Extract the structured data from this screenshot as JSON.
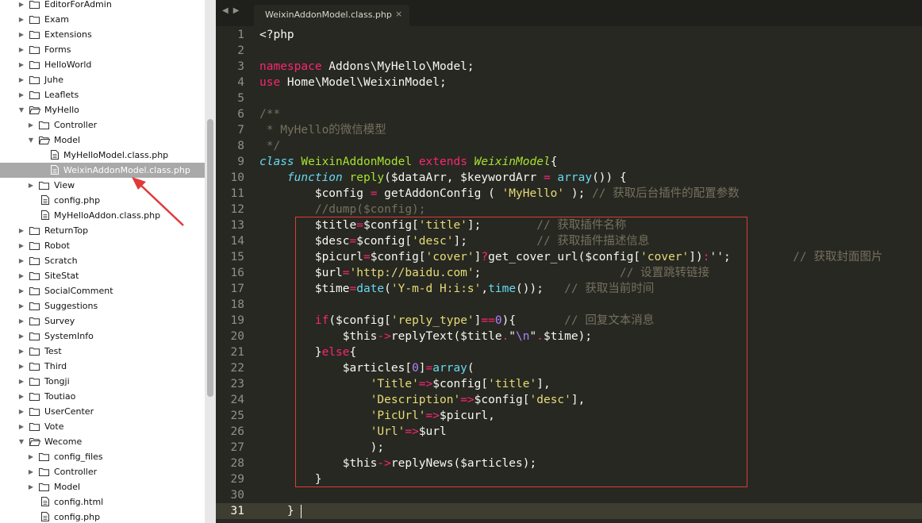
{
  "colors": {
    "editor_bg": "#272822",
    "sidebar_bg": "#ffffff",
    "selected_row_bg": "#a9a9a9",
    "annotation": "#e03a3a",
    "keyword": "#f92672",
    "string": "#e6db74",
    "comment": "#75715e",
    "function": "#66d9ef",
    "class_name": "#a6e22e",
    "number": "#ae81ff"
  },
  "sidebar": {
    "items": [
      {
        "label": "EditorForAdmin",
        "depth": 0,
        "type": "folder",
        "expanded": false
      },
      {
        "label": "Exam",
        "depth": 0,
        "type": "folder",
        "expanded": false
      },
      {
        "label": "Extensions",
        "depth": 0,
        "type": "folder",
        "expanded": false
      },
      {
        "label": "Forms",
        "depth": 0,
        "type": "folder",
        "expanded": false
      },
      {
        "label": "HelloWorld",
        "depth": 0,
        "type": "folder",
        "expanded": false
      },
      {
        "label": "Juhe",
        "depth": 0,
        "type": "folder",
        "expanded": false
      },
      {
        "label": "Leaflets",
        "depth": 0,
        "type": "folder",
        "expanded": false
      },
      {
        "label": "MyHello",
        "depth": 0,
        "type": "folder",
        "expanded": true
      },
      {
        "label": "Controller",
        "depth": 1,
        "type": "folder",
        "expanded": false
      },
      {
        "label": "Model",
        "depth": 1,
        "type": "folder",
        "expanded": true
      },
      {
        "label": "MyHelloModel.class.php",
        "depth": 2,
        "type": "file"
      },
      {
        "label": "WeixinAddonModel.class.php",
        "depth": 2,
        "type": "file",
        "selected": true
      },
      {
        "label": "View",
        "depth": 1,
        "type": "folder",
        "expanded": false
      },
      {
        "label": "config.php",
        "depth": 1,
        "type": "file"
      },
      {
        "label": "MyHelloAddon.class.php",
        "depth": 1,
        "type": "file"
      },
      {
        "label": "ReturnTop",
        "depth": 0,
        "type": "folder",
        "expanded": false
      },
      {
        "label": "Robot",
        "depth": 0,
        "type": "folder",
        "expanded": false
      },
      {
        "label": "Scratch",
        "depth": 0,
        "type": "folder",
        "expanded": false
      },
      {
        "label": "SiteStat",
        "depth": 0,
        "type": "folder",
        "expanded": false
      },
      {
        "label": "SocialComment",
        "depth": 0,
        "type": "folder",
        "expanded": false
      },
      {
        "label": "Suggestions",
        "depth": 0,
        "type": "folder",
        "expanded": false
      },
      {
        "label": "Survey",
        "depth": 0,
        "type": "folder",
        "expanded": false
      },
      {
        "label": "SystemInfo",
        "depth": 0,
        "type": "folder",
        "expanded": false
      },
      {
        "label": "Test",
        "depth": 0,
        "type": "folder",
        "expanded": false
      },
      {
        "label": "Third",
        "depth": 0,
        "type": "folder",
        "expanded": false
      },
      {
        "label": "Tongji",
        "depth": 0,
        "type": "folder",
        "expanded": false
      },
      {
        "label": "Toutiao",
        "depth": 0,
        "type": "folder",
        "expanded": false
      },
      {
        "label": "UserCenter",
        "depth": 0,
        "type": "folder",
        "expanded": false
      },
      {
        "label": "Vote",
        "depth": 0,
        "type": "folder",
        "expanded": false
      },
      {
        "label": "Wecome",
        "depth": 0,
        "type": "folder",
        "expanded": true
      },
      {
        "label": "config_files",
        "depth": 1,
        "type": "folder",
        "expanded": false
      },
      {
        "label": "Controller",
        "depth": 1,
        "type": "folder",
        "expanded": false
      },
      {
        "label": "Model",
        "depth": 1,
        "type": "folder",
        "expanded": false
      },
      {
        "label": "config.html",
        "depth": 1,
        "type": "file"
      },
      {
        "label": "config.php",
        "depth": 1,
        "type": "file"
      }
    ]
  },
  "tab": {
    "label": "WeixinAddonModel.class.php",
    "close": "×"
  },
  "nav": {
    "back": "◀",
    "forward": "▶"
  },
  "editor": {
    "current_line": 31,
    "lines": [
      {
        "n": 1,
        "tokens": [
          [
            "<?php",
            ""
          ]
        ]
      },
      {
        "n": 2,
        "tokens": []
      },
      {
        "n": 3,
        "tokens": [
          [
            "namespace",
            "kw"
          ],
          [
            " Addons\\MyHello\\Model;",
            ""
          ]
        ]
      },
      {
        "n": 4,
        "tokens": [
          [
            "use",
            "kw"
          ],
          [
            " Home\\Model\\WeixinModel;",
            ""
          ]
        ]
      },
      {
        "n": 5,
        "tokens": []
      },
      {
        "n": 6,
        "tokens": [
          [
            "/**",
            "cm"
          ]
        ]
      },
      {
        "n": 7,
        "tokens": [
          [
            " * MyHello的微信模型",
            "cm"
          ]
        ]
      },
      {
        "n": 8,
        "tokens": [
          [
            " */",
            "cm"
          ]
        ]
      },
      {
        "n": 9,
        "tokens": [
          [
            "class",
            "fi"
          ],
          [
            " ",
            ""
          ],
          [
            "WeixinAddonModel",
            "cl"
          ],
          [
            " ",
            ""
          ],
          [
            "extends",
            "kw"
          ],
          [
            " ",
            ""
          ],
          [
            "WeixinModel",
            "cli"
          ],
          [
            "{",
            ""
          ]
        ]
      },
      {
        "n": 10,
        "tokens": [
          [
            "    ",
            ""
          ],
          [
            "function",
            "fi"
          ],
          [
            " ",
            ""
          ],
          [
            "reply",
            "cl"
          ],
          [
            "($dataArr, $keywordArr ",
            ""
          ],
          [
            "=",
            "kw"
          ],
          [
            " ",
            ""
          ],
          [
            "array",
            "fn"
          ],
          [
            "()) {",
            ""
          ]
        ]
      },
      {
        "n": 11,
        "tokens": [
          [
            "        $config ",
            ""
          ],
          [
            "=",
            "kw"
          ],
          [
            " getAddonConfig ( ",
            ""
          ],
          [
            "'MyHello'",
            "st"
          ],
          [
            " ); ",
            ""
          ],
          [
            "// 获取后台插件的配置参数",
            "cm"
          ]
        ]
      },
      {
        "n": 12,
        "tokens": [
          [
            "        ",
            ""
          ],
          [
            "//dump($config);",
            "cm"
          ]
        ]
      },
      {
        "n": 13,
        "tokens": [
          [
            "        $title",
            ""
          ],
          [
            "=",
            "kw"
          ],
          [
            "$config[",
            ""
          ],
          [
            "'title'",
            "st"
          ],
          [
            "];        ",
            ""
          ],
          [
            "// 获取插件名称",
            "cm"
          ]
        ]
      },
      {
        "n": 14,
        "tokens": [
          [
            "        $desc",
            ""
          ],
          [
            "=",
            "kw"
          ],
          [
            "$config[",
            ""
          ],
          [
            "'desc'",
            "st"
          ],
          [
            "];          ",
            ""
          ],
          [
            "// 获取插件描述信息",
            "cm"
          ]
        ]
      },
      {
        "n": 15,
        "tokens": [
          [
            "        $picurl",
            ""
          ],
          [
            "=",
            "kw"
          ],
          [
            "$config[",
            ""
          ],
          [
            "'cover'",
            "st"
          ],
          [
            "]",
            ""
          ],
          [
            "?",
            "kw"
          ],
          [
            "get_cover_url($config[",
            ""
          ],
          [
            "'cover'",
            "st"
          ],
          [
            "])",
            ""
          ],
          [
            ":",
            "kw"
          ],
          [
            "'';         ",
            ""
          ],
          [
            "// 获取封面图片",
            "cm"
          ]
        ]
      },
      {
        "n": 16,
        "tokens": [
          [
            "        $url",
            ""
          ],
          [
            "=",
            "kw"
          ],
          [
            "'http://baidu.com'",
            "st"
          ],
          [
            ";                    ",
            ""
          ],
          [
            "// 设置跳转链接",
            "cm"
          ]
        ]
      },
      {
        "n": 17,
        "tokens": [
          [
            "        $time",
            ""
          ],
          [
            "=",
            "kw"
          ],
          [
            "date",
            "fn"
          ],
          [
            "(",
            ""
          ],
          [
            "'Y-m-d H:i:s'",
            "st"
          ],
          [
            ",",
            ""
          ],
          [
            "time",
            "fn"
          ],
          [
            "());   ",
            ""
          ],
          [
            "// 获取当前时间",
            "cm"
          ]
        ]
      },
      {
        "n": 18,
        "tokens": []
      },
      {
        "n": 19,
        "tokens": [
          [
            "        ",
            ""
          ],
          [
            "if",
            "kw"
          ],
          [
            "($config[",
            ""
          ],
          [
            "'reply_type'",
            "st"
          ],
          [
            "]",
            ""
          ],
          [
            "==",
            "kw"
          ],
          [
            "0",
            "nm"
          ],
          [
            "){       ",
            ""
          ],
          [
            "// 回复文本消息",
            "cm"
          ]
        ]
      },
      {
        "n": 20,
        "tokens": [
          [
            "            $this",
            ""
          ],
          [
            "->",
            "kw"
          ],
          [
            "replyText($title",
            ""
          ],
          [
            ".",
            "kw"
          ],
          [
            "\"",
            ""
          ],
          [
            "\\n",
            "nm"
          ],
          [
            "\"",
            ""
          ],
          [
            ".",
            "kw"
          ],
          [
            "$time);",
            ""
          ]
        ]
      },
      {
        "n": 21,
        "tokens": [
          [
            "        }",
            ""
          ],
          [
            "else",
            "kw"
          ],
          [
            "{",
            ""
          ]
        ]
      },
      {
        "n": 22,
        "tokens": [
          [
            "            $articles[",
            ""
          ],
          [
            "0",
            "nm"
          ],
          [
            "]",
            ""
          ],
          [
            "=",
            "kw"
          ],
          [
            "array",
            "fn"
          ],
          [
            "(",
            ""
          ]
        ]
      },
      {
        "n": 23,
        "tokens": [
          [
            "                ",
            ""
          ],
          [
            "'Title'",
            "st"
          ],
          [
            "=>",
            "kw"
          ],
          [
            "$config[",
            ""
          ],
          [
            "'title'",
            "st"
          ],
          [
            "],",
            ""
          ]
        ]
      },
      {
        "n": 24,
        "tokens": [
          [
            "                ",
            ""
          ],
          [
            "'Description'",
            "st"
          ],
          [
            "=>",
            "kw"
          ],
          [
            "$config[",
            ""
          ],
          [
            "'desc'",
            "st"
          ],
          [
            "],",
            ""
          ]
        ]
      },
      {
        "n": 25,
        "tokens": [
          [
            "                ",
            ""
          ],
          [
            "'PicUrl'",
            "st"
          ],
          [
            "=>",
            "kw"
          ],
          [
            "$picurl,",
            ""
          ]
        ]
      },
      {
        "n": 26,
        "tokens": [
          [
            "                ",
            ""
          ],
          [
            "'Url'",
            "st"
          ],
          [
            "=>",
            "kw"
          ],
          [
            "$url",
            ""
          ]
        ]
      },
      {
        "n": 27,
        "tokens": [
          [
            "                );",
            ""
          ]
        ]
      },
      {
        "n": 28,
        "tokens": [
          [
            "            $this",
            ""
          ],
          [
            "->",
            "kw"
          ],
          [
            "replyNews($articles);",
            ""
          ]
        ]
      },
      {
        "n": 29,
        "tokens": [
          [
            "        }",
            ""
          ]
        ]
      },
      {
        "n": 30,
        "tokens": []
      },
      {
        "n": 31,
        "tokens": [
          [
            "    } ",
            ""
          ]
        ]
      }
    ]
  }
}
